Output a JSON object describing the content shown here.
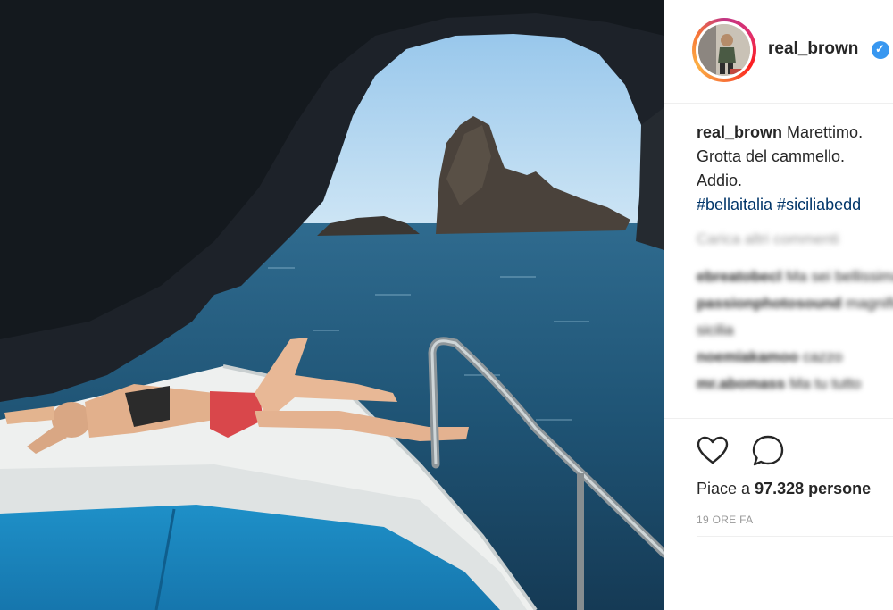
{
  "post": {
    "image_alt": "Woman sunbathing on the bow of a boat inside a sea cave arch, with a rock stack in the blue sea",
    "username": "real_brown",
    "verified": true,
    "caption": {
      "username": "real_brown",
      "lines": [
        "Marettimo.",
        "Grotta del cammello.",
        "Addio."
      ],
      "hashtags": "#bellaitalia #siciliabedd"
    },
    "load_more": "Carica altri commenti",
    "comments": [
      {
        "user": "ebreatobecl",
        "text": "Ma sei bellissima"
      },
      {
        "user": "passionphotosound",
        "text": "magnifique"
      },
      {
        "user": "",
        "text": "sicilia"
      },
      {
        "user": "noemiakamoo",
        "text": "cazzo"
      },
      {
        "user": "mr.abomass",
        "text": "Ma tu tutto"
      }
    ],
    "actions": {
      "like_icon": "heart-outline-icon",
      "comment_icon": "speech-bubble-icon"
    },
    "likes": {
      "prefix": "Piace a",
      "count": "97.328",
      "suffix": "persone"
    },
    "timestamp": "19 ORE FA"
  },
  "colors": {
    "verified_badge": "#3897f0",
    "hashtag": "#003569",
    "text": "#262626",
    "muted": "#999999"
  }
}
